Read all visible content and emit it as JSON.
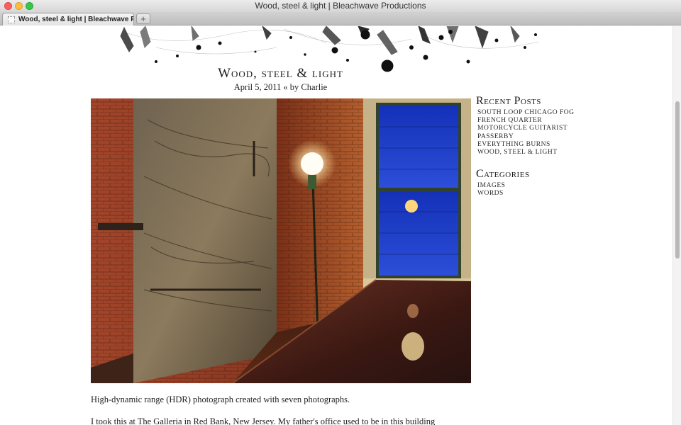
{
  "window": {
    "title": "Wood, steel & light | Bleachwave Productions",
    "tab_label": "Wood, steel & light | Bleachwave Productions",
    "new_tab_label": "+"
  },
  "post": {
    "title": "Wood, steel & light",
    "meta": "April 5, 2011 « by Charlie",
    "paragraphs": [
      "High-dynamic range (HDR) photograph created with seven photographs.",
      "I took this at The Galleria in Red Bank, New Jersey. My father's office used to be in this building"
    ]
  },
  "sidebar": {
    "recent_heading": "Recent Posts",
    "recent_posts": [
      "South Loop Chicago Fog",
      "French Quarter",
      "Motorcycle Guitarist",
      "Passerby",
      "Everything Burns",
      "Wood, steel & light"
    ],
    "categories_heading": "Categories",
    "categories": [
      "Images",
      "Words"
    ]
  },
  "colors": {
    "window_glow": "#1d3fd0",
    "lamp": "#fff6dd",
    "brick": "#8a3a22"
  }
}
